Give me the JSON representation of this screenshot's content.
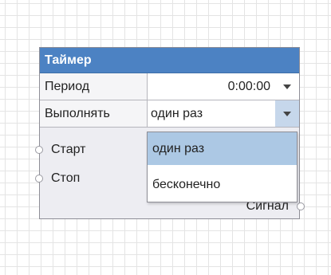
{
  "node": {
    "title": "Таймер",
    "properties": [
      {
        "label": "Период",
        "value": "0:00:00"
      },
      {
        "label": "Выполнять",
        "value": "один раз"
      }
    ],
    "inputs": [
      "Старт",
      "Стоп"
    ],
    "outputs": [
      "Сигнал"
    ]
  },
  "dropdown": {
    "options": [
      "один раз",
      "бесконечно"
    ],
    "selected": "один раз"
  },
  "icons": {
    "dropdown_arrow": "chevron-down-icon",
    "port": "port-circle-icon"
  },
  "colors": {
    "header": "#4c82c3",
    "node_body": "#ededf2",
    "selected_option": "#acc8e4",
    "active_arrow": "#c6d7eb"
  }
}
